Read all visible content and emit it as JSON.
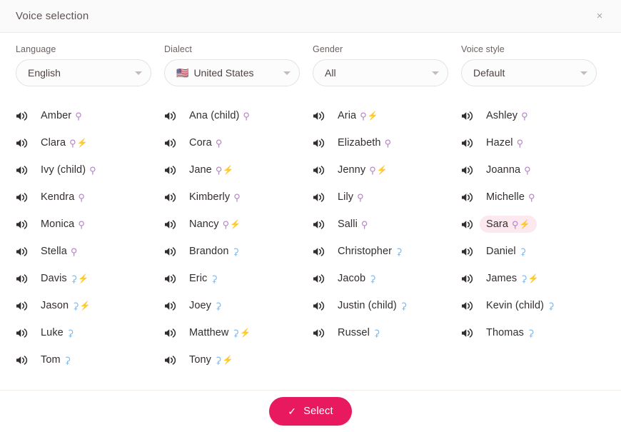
{
  "header": {
    "title": "Voice selection",
    "close_icon": "close-icon",
    "close_glyph": "×"
  },
  "filters": [
    {
      "label": "Language",
      "value": "English",
      "flag": "",
      "name": "language"
    },
    {
      "label": "Dialect",
      "value": "United States",
      "flag": "🇺🇸",
      "name": "dialect"
    },
    {
      "label": "Gender",
      "value": "All",
      "flag": "",
      "name": "gender"
    },
    {
      "label": "Voice style",
      "value": "Default",
      "flag": "",
      "name": "voice-style"
    }
  ],
  "icons": {
    "speaker": "speaker-icon",
    "caret": "chevron-down-icon",
    "female_glyph": "⚲",
    "male_glyph": "⚳",
    "bolt_glyph": "⚡",
    "check_glyph": "✓"
  },
  "colors": {
    "accent": "#e8195f",
    "selected_pill_bg": "#fce9ef",
    "female": "#b37fc6",
    "male": "#7fb6e3",
    "bolt": "#f6c324",
    "header_bg": "#fbfafa",
    "text": "#332e2d"
  },
  "voice_columns": [
    [
      {
        "name": "Amber",
        "gender": "female",
        "neural": false,
        "selected": false
      },
      {
        "name": "Clara",
        "gender": "female",
        "neural": true,
        "selected": false
      },
      {
        "name": "Ivy (child)",
        "gender": "female",
        "neural": false,
        "selected": false
      },
      {
        "name": "Kendra",
        "gender": "female",
        "neural": false,
        "selected": false
      },
      {
        "name": "Monica",
        "gender": "female",
        "neural": false,
        "selected": false
      },
      {
        "name": "Stella",
        "gender": "female",
        "neural": false,
        "selected": false
      },
      {
        "name": "Davis",
        "gender": "male",
        "neural": true,
        "selected": false
      },
      {
        "name": "Jason",
        "gender": "male",
        "neural": true,
        "selected": false
      },
      {
        "name": "Luke",
        "gender": "male",
        "neural": false,
        "selected": false
      },
      {
        "name": "Tom",
        "gender": "male",
        "neural": false,
        "selected": false
      }
    ],
    [
      {
        "name": "Ana (child)",
        "gender": "female",
        "neural": false,
        "selected": false
      },
      {
        "name": "Cora",
        "gender": "female",
        "neural": false,
        "selected": false
      },
      {
        "name": "Jane",
        "gender": "female",
        "neural": true,
        "selected": false
      },
      {
        "name": "Kimberly",
        "gender": "female",
        "neural": false,
        "selected": false
      },
      {
        "name": "Nancy",
        "gender": "female",
        "neural": true,
        "selected": false
      },
      {
        "name": "Brandon",
        "gender": "male",
        "neural": false,
        "selected": false
      },
      {
        "name": "Eric",
        "gender": "male",
        "neural": false,
        "selected": false
      },
      {
        "name": "Joey",
        "gender": "male",
        "neural": false,
        "selected": false
      },
      {
        "name": "Matthew",
        "gender": "male",
        "neural": true,
        "selected": false
      },
      {
        "name": "Tony",
        "gender": "male",
        "neural": true,
        "selected": false
      }
    ],
    [
      {
        "name": "Aria",
        "gender": "female",
        "neural": true,
        "selected": false
      },
      {
        "name": "Elizabeth",
        "gender": "female",
        "neural": false,
        "selected": false
      },
      {
        "name": "Jenny",
        "gender": "female",
        "neural": true,
        "selected": false
      },
      {
        "name": "Lily",
        "gender": "female",
        "neural": false,
        "selected": false
      },
      {
        "name": "Salli",
        "gender": "female",
        "neural": false,
        "selected": false
      },
      {
        "name": "Christopher",
        "gender": "male",
        "neural": false,
        "selected": false
      },
      {
        "name": "Jacob",
        "gender": "male",
        "neural": false,
        "selected": false
      },
      {
        "name": "Justin (child)",
        "gender": "male",
        "neural": false,
        "selected": false
      },
      {
        "name": "Russel",
        "gender": "male",
        "neural": false,
        "selected": false
      }
    ],
    [
      {
        "name": "Ashley",
        "gender": "female",
        "neural": false,
        "selected": false
      },
      {
        "name": "Hazel",
        "gender": "female",
        "neural": false,
        "selected": false
      },
      {
        "name": "Joanna",
        "gender": "female",
        "neural": false,
        "selected": false
      },
      {
        "name": "Michelle",
        "gender": "female",
        "neural": false,
        "selected": false
      },
      {
        "name": "Sara",
        "gender": "female",
        "neural": true,
        "selected": true
      },
      {
        "name": "Daniel",
        "gender": "male",
        "neural": false,
        "selected": false
      },
      {
        "name": "James",
        "gender": "male",
        "neural": true,
        "selected": false
      },
      {
        "name": "Kevin (child)",
        "gender": "male",
        "neural": false,
        "selected": false
      },
      {
        "name": "Thomas",
        "gender": "male",
        "neural": false,
        "selected": false
      }
    ]
  ],
  "footer": {
    "select_label": "Select"
  }
}
